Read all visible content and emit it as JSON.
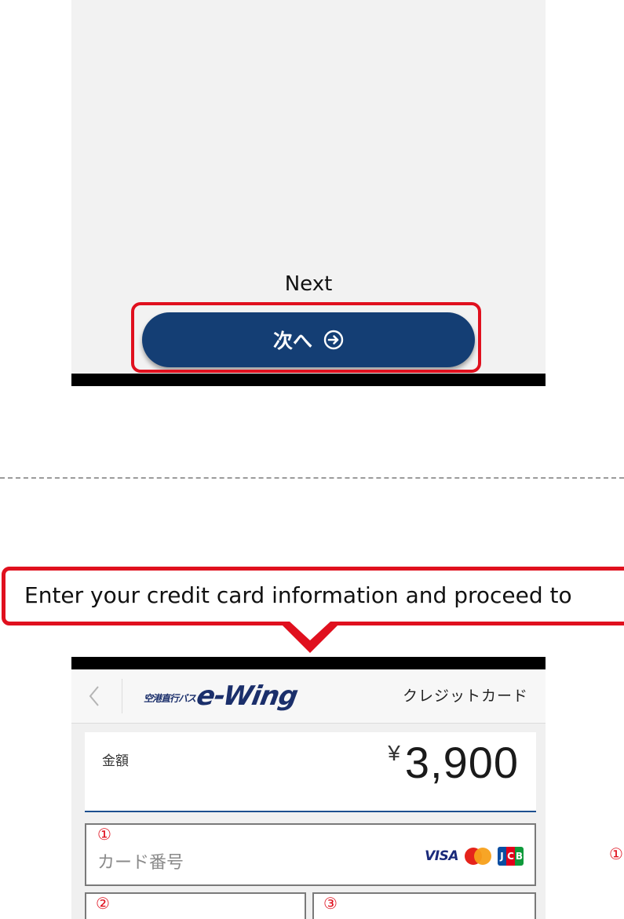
{
  "top_screen": {
    "next_caption": "Next",
    "next_button_label": "次へ"
  },
  "callout": {
    "text": "Enter your credit card information and proceed to"
  },
  "payment_screen": {
    "logo_small": "空港直行バス",
    "logo_big": "e-Wing",
    "header_title": "クレジットカード",
    "amount_label": "金額",
    "currency_symbol": "¥",
    "amount_value": "3,900",
    "card_number_marker": "①",
    "card_number_placeholder": "カード番号",
    "card_brands": {
      "visa": "VISA",
      "jcb": [
        "J",
        "C",
        "B"
      ]
    },
    "second_row_markers": [
      "②",
      "③"
    ],
    "side_marker": "①"
  },
  "colors": {
    "button_navy": "#143e74",
    "highlight_red": "#e0101e",
    "amount_underline": "#1d4f8f",
    "logo_navy": "#1b2f6b"
  },
  "icons": [
    "arrow-right-circle-icon",
    "chevron-left-icon",
    "mastercard-icon"
  ]
}
